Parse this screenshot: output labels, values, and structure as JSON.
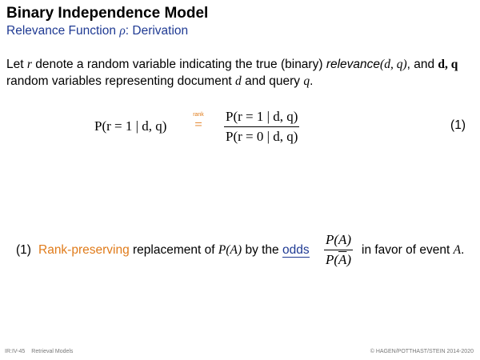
{
  "header": {
    "title": "Binary Independence Model",
    "subtitle_prefix": "Relevance Function ",
    "subtitle_symbol": "ρ",
    "subtitle_suffix": ": Derivation"
  },
  "intro": {
    "part1": "Let ",
    "var_r": "r",
    "part2": " denote a random variable indicating the true (binary) ",
    "relevance_word": "relevance",
    "relevance_args": "(d, q)",
    "part3": ", and ",
    "vars_dq": "d, q",
    "part4": " random variables representing document ",
    "var_d": "d",
    "part5": " and query ",
    "var_q": "q",
    "part6": "."
  },
  "equation": {
    "lhs": "P(r = 1 | d, q)",
    "relation_label": "rank",
    "relation_symbol": "=",
    "numerator": "P(r = 1 | d, q)",
    "denominator": "P(r = 0 | d, q)",
    "number": "(1)"
  },
  "note": {
    "marker": "(1)",
    "highlight": "Rank-preserving",
    "text_a": " replacement of ",
    "expr": "P(A)",
    "text_b": " by the ",
    "link_text": "odds",
    "frac_num": "P(A)",
    "frac_den_prefix": "P(",
    "frac_den_var": "A",
    "frac_den_suffix": ")",
    "text_c": " in favor of event ",
    "event_var": "A",
    "text_d": "."
  },
  "footer": {
    "left_code": "IR:IV-45",
    "left_title": "Retrieval Models",
    "right": "© HAGEN/POTTHAST/STEIN 2014-2020"
  },
  "colors": {
    "title": "#000000",
    "subtitle": "#1f3a93",
    "highlight": "#e07b1a",
    "link": "#1f3a93",
    "footer": "#777777"
  }
}
